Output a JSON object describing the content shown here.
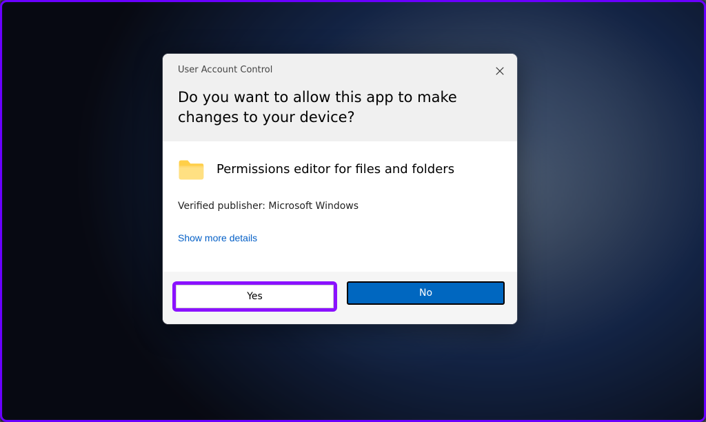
{
  "dialog": {
    "title_small": "User Account Control",
    "heading": "Do you want to allow this app to make changes to your device?",
    "app_name": "Permissions editor for files and folders",
    "publisher_label": "Verified publisher: Microsoft Windows",
    "show_more_label": "Show more details",
    "yes_label": "Yes",
    "no_label": "No"
  }
}
